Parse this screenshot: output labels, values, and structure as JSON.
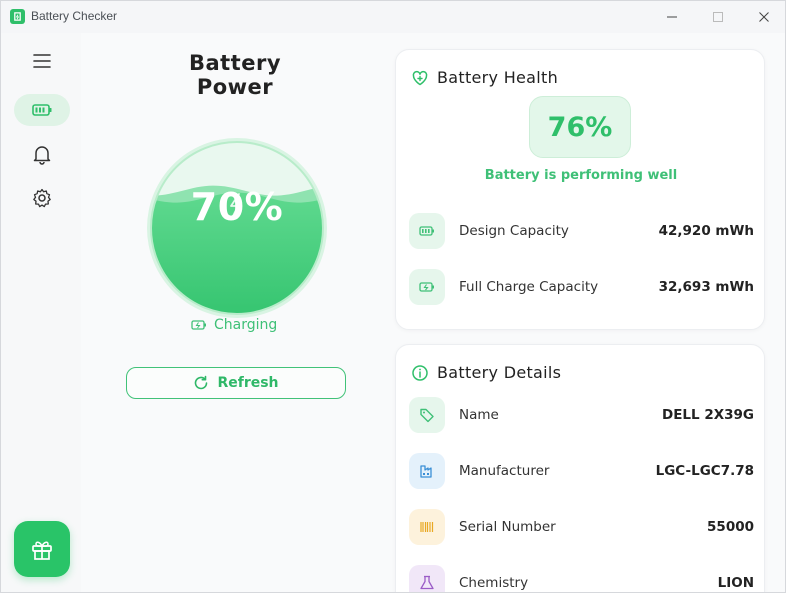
{
  "window": {
    "title": "Battery Checker"
  },
  "sidebar": {
    "items": [
      {
        "name": "menu",
        "icon": "menu-icon"
      },
      {
        "name": "battery",
        "icon": "battery-icon",
        "active": true
      },
      {
        "name": "notifications",
        "icon": "bell-icon"
      },
      {
        "name": "settings",
        "icon": "gear-icon"
      }
    ],
    "gift": {
      "icon": "gift-icon"
    }
  },
  "power": {
    "title": "Battery Power",
    "percent_label": "70%",
    "level": 0.7,
    "status": "Charging",
    "refresh_label": "Refresh"
  },
  "health": {
    "title": "Battery Health",
    "percent_label": "76%",
    "message": "Battery is performing well",
    "rows": [
      {
        "label": "Design Capacity",
        "value": "42,920 mWh",
        "icon": "battery-icon"
      },
      {
        "label": "Full Charge Capacity",
        "value": "32,693 mWh",
        "icon": "battery-charging-icon"
      }
    ]
  },
  "details": {
    "title": "Battery Details",
    "rows": [
      {
        "label": "Name",
        "value": "DELL 2X39G",
        "icon": "tag-icon"
      },
      {
        "label": "Manufacturer",
        "value": "LGC-LGC7.78",
        "icon": "factory-icon"
      },
      {
        "label": "Serial Number",
        "value": "55000",
        "icon": "barcode-icon"
      },
      {
        "label": "Chemistry",
        "value": "LION",
        "icon": "flask-icon"
      }
    ]
  },
  "colors": {
    "accent": "#2fbf6a",
    "accent_light": "#e3f7ea",
    "text": "#222222"
  }
}
